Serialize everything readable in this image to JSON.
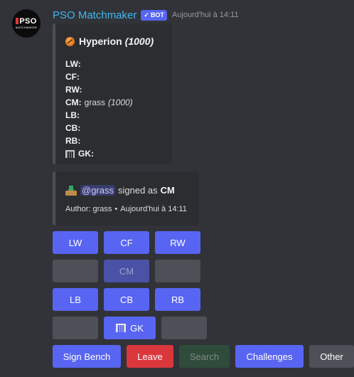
{
  "message": {
    "author": "PSO Matchmaker",
    "bot_tag": "BOT",
    "timestamp": "Aujourd'hui à 14:11",
    "avatar": {
      "logo_text": "PSO",
      "logo_subtext": "MATCHMAKER"
    }
  },
  "team_embed": {
    "icon": "soccer-ball-icon",
    "team_name": "Hyperion",
    "team_rating": "(1000)",
    "positions": [
      {
        "label": "LW:",
        "player": "",
        "rating": ""
      },
      {
        "label": "CF:",
        "player": "",
        "rating": ""
      },
      {
        "label": "RW:",
        "player": "",
        "rating": ""
      },
      {
        "label": "CM:",
        "player": "grass",
        "rating": "(1000)"
      },
      {
        "label": "LB:",
        "player": "",
        "rating": ""
      },
      {
        "label": "CB:",
        "player": "",
        "rating": ""
      },
      {
        "label": "RB:",
        "player": "",
        "rating": ""
      },
      {
        "label": "GK:",
        "player": "",
        "rating": "",
        "icon": "goal-net-icon"
      }
    ]
  },
  "signup_embed": {
    "icon": "inbox-tray-icon",
    "mention": "@grass",
    "text": "signed as",
    "position": "CM",
    "footer_author": "Author: grass",
    "footer_separator": "•",
    "footer_time": "Aujourd'hui à 14:11"
  },
  "buttons": {
    "lw": "LW",
    "cf": "CF",
    "rw": "RW",
    "cm": "CM",
    "lb": "LB",
    "cb": "CB",
    "rb": "RB",
    "gk": "GK",
    "sign_bench": "Sign Bench",
    "leave": "Leave",
    "search": "Search",
    "challenges": "Challenges",
    "other": "Other"
  },
  "colors": {
    "background": "#313338",
    "embed": "#2b2d31",
    "blurple": "#5865f2",
    "danger": "#da373c",
    "secondary": "#4e5058",
    "username": "#3fb8f0"
  }
}
